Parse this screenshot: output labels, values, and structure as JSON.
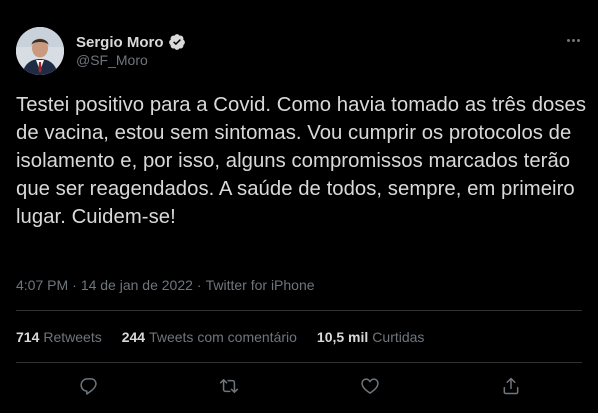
{
  "author": {
    "display_name": "Sergio Moro",
    "handle": "@SF_Moro",
    "verified_icon": "verified-badge-icon",
    "avatar_icon": "profile-photo"
  },
  "tweet": {
    "text": "Testei positivo para a Covid. Como havia tomado as três doses de vacina, estou sem sintomas. Vou cumprir os protocolos de isolamento e, por isso, alguns compromissos marcados terão que ser reagendados. A saúde de todos, sempre, em primeiro lugar. Cuidem-se!"
  },
  "meta": {
    "time": "4:07 PM",
    "separator": "·",
    "date": "14 de jan de 2022",
    "source": "Twitter for iPhone"
  },
  "stats": [
    {
      "count": "714",
      "label": "Retweets"
    },
    {
      "count": "244",
      "label": "Tweets com comentário"
    },
    {
      "count": "10,5 mil",
      "label": "Curtidas"
    }
  ],
  "actions": {
    "reply_icon": "reply-icon",
    "retweet_icon": "retweet-icon",
    "like_icon": "heart-icon",
    "share_icon": "share-icon"
  },
  "colors": {
    "background": "#000000",
    "primary_text": "#d9d9d9",
    "secondary_text": "#6e767d",
    "divider": "#2f3336"
  }
}
